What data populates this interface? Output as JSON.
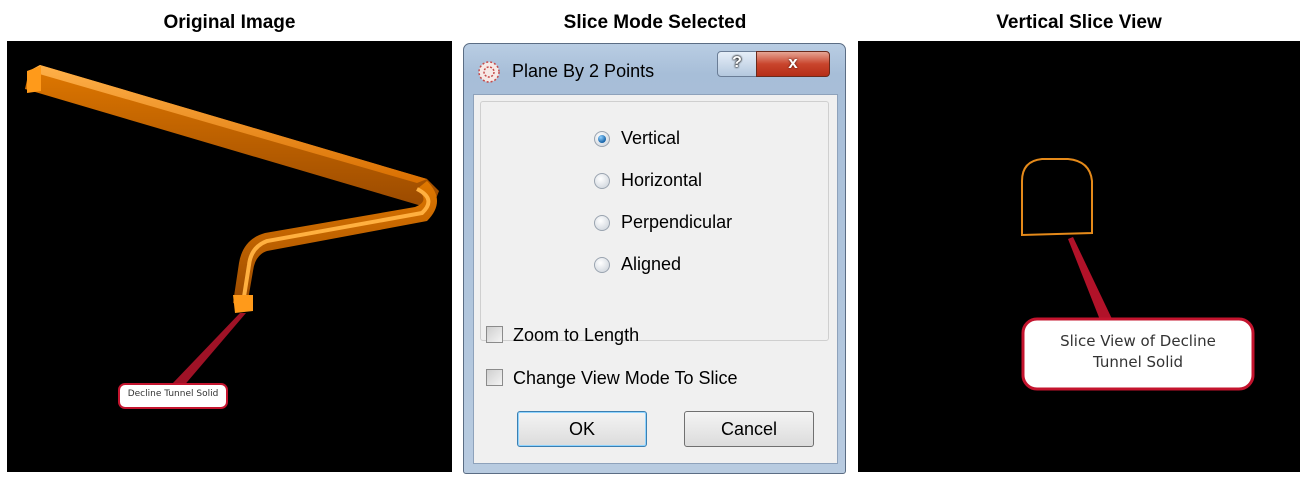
{
  "panels": {
    "left_title": "Original Image",
    "middle_title": "Slice Mode Selected",
    "right_title": "Vertical Slice View"
  },
  "left_view": {
    "callout": "Decline Tunnel Solid",
    "colors": {
      "background": "#000000",
      "solid": "#f08a00"
    }
  },
  "right_view": {
    "callout_line1": "Slice View of Decline",
    "callout_line2": "Tunnel Solid",
    "colors": {
      "background": "#000000",
      "outline": "#e58a1a"
    }
  },
  "dialog": {
    "title": "Plane By 2 Points",
    "help_label": "?",
    "close_label": "x",
    "icons": {
      "app": "app-icon",
      "help": "help-icon",
      "close": "close-icon"
    },
    "plane_options": [
      {
        "label": "Vertical",
        "checked": true
      },
      {
        "label": "Horizontal",
        "checked": false
      },
      {
        "label": "Perpendicular",
        "checked": false
      },
      {
        "label": "Aligned",
        "checked": false
      }
    ],
    "checkboxes": [
      {
        "label": "Zoom to Length",
        "checked": false
      },
      {
        "label": "Change View Mode To Slice",
        "checked": false
      }
    ],
    "ok_label": "OK",
    "cancel_label": "Cancel"
  }
}
